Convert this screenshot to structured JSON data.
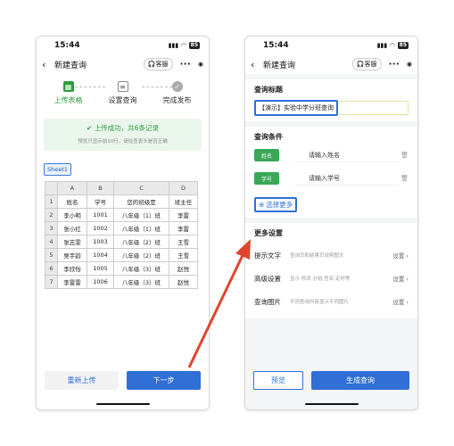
{
  "left": {
    "status_time": "15:44",
    "status_battery": "85",
    "nav_title": "新建查询",
    "kefu_label": "客服",
    "steps": [
      {
        "label": "上传表格"
      },
      {
        "label": "设置查询"
      },
      {
        "label": "完成发布"
      }
    ],
    "notice_ok": "上传成功，共6条记录",
    "notice_sub": "预览只显示前10行，请检查表头是否正确",
    "sheet_tab": "Sheet1",
    "columns": [
      "A",
      "B",
      "C",
      "D"
    ],
    "rows": [
      {
        "n": "1",
        "c": [
          "姓名",
          "学号",
          "您的班级是",
          "班主任"
        ]
      },
      {
        "n": "2",
        "c": [
          "李小明",
          "1001",
          "八年级（1）班",
          "李雷"
        ]
      },
      {
        "n": "3",
        "c": [
          "张小红",
          "1002",
          "八年级（1）班",
          "李雷"
        ]
      },
      {
        "n": "4",
        "c": [
          "张志雯",
          "1003",
          "八年级（2）班",
          "王雪"
        ]
      },
      {
        "n": "5",
        "c": [
          "吴宇韵",
          "1004",
          "八年级（2）班",
          "王雪"
        ]
      },
      {
        "n": "6",
        "c": [
          "李欣怡",
          "1005",
          "八年级（3）班",
          "赵悦"
        ]
      },
      {
        "n": "7",
        "c": [
          "李雷雷",
          "1006",
          "八年级（3）班",
          "赵悦"
        ]
      }
    ],
    "reupload_label": "重新上传",
    "next_label": "下一步"
  },
  "right": {
    "status_time": "15:44",
    "status_battery": "85",
    "nav_title": "新建查询",
    "kefu_label": "客服",
    "title_section": "查询标题",
    "title_value": "【演示】实验中学分班查询",
    "cond_section": "查询条件",
    "conditions": [
      {
        "tag": "姓名",
        "placeholder": "请输入姓名"
      },
      {
        "tag": "学号",
        "placeholder": "请输入学号"
      }
    ],
    "select_more": "选择更多",
    "more_section": "更多设置",
    "settings": [
      {
        "label": "提示文字",
        "desc": "查询页和结果页说明图文",
        "action": "设置"
      },
      {
        "label": "高级设置",
        "desc": "显示 修改 分组 签名 定时等",
        "action": "设置"
      },
      {
        "label": "查询图片",
        "desc": "不同查询内容显示不同图片",
        "action": "设置"
      }
    ],
    "preview_label": "预览",
    "generate_label": "生成查询"
  },
  "colors": {
    "accent_blue": "#2f6fd6",
    "success_green": "#2e9b3e",
    "arrow_red": "#e0452f"
  }
}
